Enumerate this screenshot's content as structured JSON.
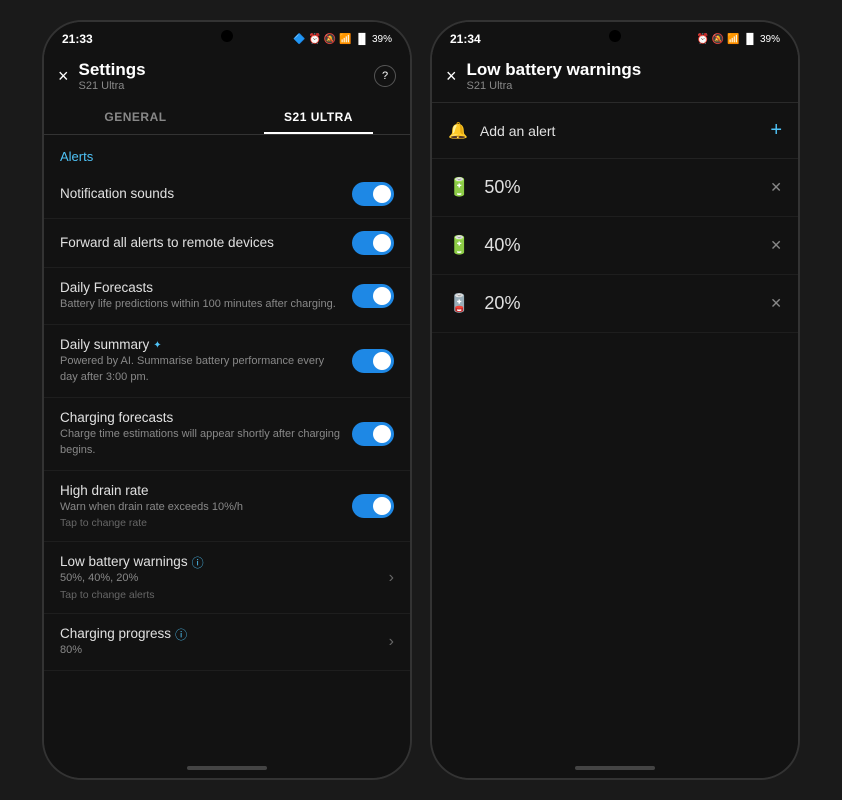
{
  "phone1": {
    "status_time": "21:33",
    "status_icons": "🔔 📵 📶 39%",
    "header": {
      "title": "Settings",
      "subtitle": "S21 Ultra",
      "close_label": "×",
      "help_label": "?"
    },
    "tabs": [
      {
        "label": "GENERAL",
        "active": false
      },
      {
        "label": "S21 ULTRA",
        "active": true
      }
    ],
    "section_label": "Alerts",
    "settings": [
      {
        "title": "Notification sounds",
        "desc": "",
        "hint": "",
        "toggle": true,
        "value": "",
        "clickable": false
      },
      {
        "title": "Forward all alerts to remote devices",
        "desc": "",
        "hint": "",
        "toggle": true,
        "value": "",
        "clickable": false
      },
      {
        "title": "Daily Forecasts",
        "desc": "Battery life predictions within 100 minutes after charging.",
        "hint": "",
        "toggle": true,
        "value": "",
        "clickable": false
      },
      {
        "title": "Daily summary",
        "ai": "✦",
        "desc": "Powered by AI. Summarise battery performance every day after 3:00 pm.",
        "hint": "",
        "toggle": true,
        "value": "",
        "clickable": false
      },
      {
        "title": "Charging forecasts",
        "desc": "Charge time estimations will appear shortly after charging begins.",
        "hint": "",
        "toggle": true,
        "value": "",
        "clickable": false
      },
      {
        "title": "High drain rate",
        "desc": "Warn when drain rate exceeds 10%/h",
        "hint": "Tap to change rate",
        "toggle": true,
        "value": "",
        "clickable": false
      },
      {
        "title": "Low battery warnings",
        "info": true,
        "desc": "50%, 40%, 20%",
        "hint": "Tap to change alerts",
        "toggle": false,
        "value": "",
        "clickable": true
      },
      {
        "title": "Charging progress",
        "info": true,
        "desc": "80%",
        "hint": "",
        "toggle": false,
        "value": "",
        "clickable": true
      }
    ]
  },
  "phone2": {
    "status_time": "21:34",
    "status_icons": "🔔 📵 📶 39%",
    "header": {
      "title": "Low battery warnings",
      "subtitle": "S21 Ultra",
      "close_label": "×"
    },
    "add_alert_label": "Add an alert",
    "plus_label": "+",
    "alerts": [
      {
        "percent": "50%"
      },
      {
        "percent": "40%"
      },
      {
        "percent": "20%"
      }
    ]
  }
}
